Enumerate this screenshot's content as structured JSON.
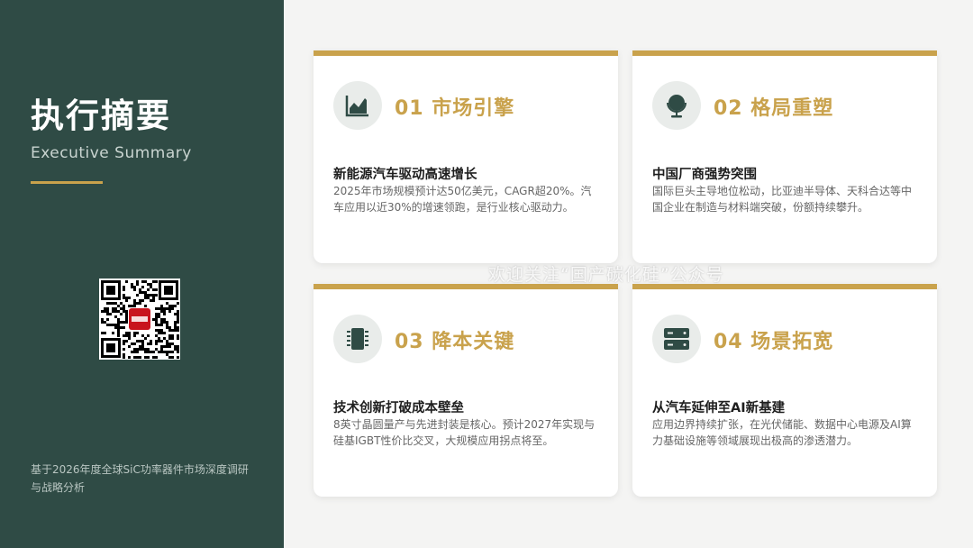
{
  "sidebar": {
    "title": "执行摘要",
    "subtitle": "Executive Summary",
    "footer": "基于2026年度全球SiC功率器件市场深度调研与战略分析"
  },
  "colors": {
    "sidebar_bg": "#2f4b45",
    "accent_gold": "#c9a24c"
  },
  "cards": [
    {
      "icon": "chart-area-icon",
      "number_title": "01 市场引擎",
      "heading": "新能源汽车驱动高速增长",
      "body": "2025年市场规模预计达50亿美元，CAGR超20%。汽车应用以近30%的增速领跑，是行业核心驱动力。"
    },
    {
      "icon": "globe-icon",
      "number_title": "02 格局重塑",
      "heading": "中国厂商强势突围",
      "body": "国际巨头主导地位松动，比亚迪半导体、天科合达等中国企业在制造与材料端突破，份额持续攀升。"
    },
    {
      "icon": "chip-icon",
      "number_title": "03 降本关键",
      "heading": "技术创新打破成本壁垒",
      "body": "8英寸晶圆量产与先进封装是核心。预计2027年实现与硅基IGBT性价比交叉，大规模应用拐点将至。"
    },
    {
      "icon": "server-icon",
      "number_title": "04 场景拓宽",
      "heading": "从汽车延伸至AI新基建",
      "body": "应用边界持续扩张，在光伏储能、数据中心电源及AI算力基础设施等领域展现出极高的渗透潜力。"
    }
  ],
  "watermark": "欢迎关注“国产碳化硅”公众号"
}
